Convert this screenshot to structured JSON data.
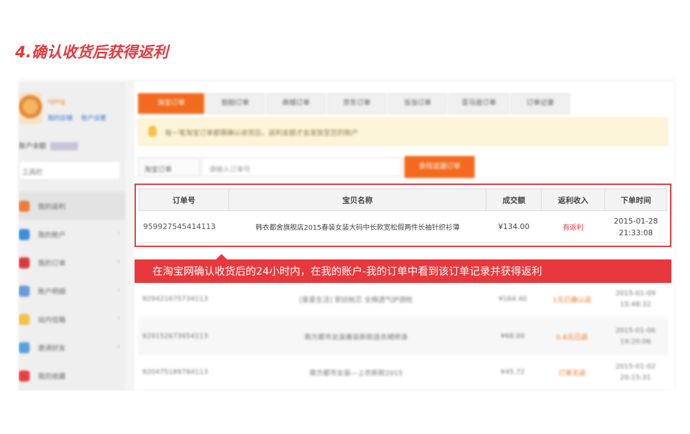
{
  "step_title": "4.确认收货后获得返利",
  "background": {
    "profile": {
      "name": "njmg",
      "links": [
        "我的店铺",
        "账户设置"
      ]
    },
    "account_label": "账户余额",
    "tools_label": "工具栏",
    "side_menu": [
      {
        "label": "我的返利",
        "icon": "gift-icon",
        "color": "#f07a3a"
      },
      {
        "label": "我的账户",
        "icon": "user-icon",
        "color": "#3a8fd8"
      },
      {
        "label": "我的订单",
        "icon": "order-icon",
        "color": "#d83a3a"
      },
      {
        "label": "账户明细",
        "icon": "list-icon",
        "color": "#6a9ad8"
      },
      {
        "label": "站内信箱",
        "icon": "mail-icon",
        "color": "#f5c243"
      },
      {
        "label": "邀请好友",
        "icon": "friends-icon",
        "color": "#5aa0e0"
      },
      {
        "label": "我的收藏",
        "icon": "heart-icon",
        "color": "#e84040"
      }
    ],
    "tabs": [
      "淘宝订单",
      "拍拍订单",
      "商城订单",
      "京东订单",
      "当当订单",
      "亚马逊订单",
      "订单记录"
    ],
    "notice": "每一笔淘宝订单都需确认收货后，返利金额才会发放至您的账户",
    "search_select": "淘宝订单",
    "search_placeholder": "请输入订单号",
    "search_button": "查找遗漏订单",
    "blurred_rows": [
      {
        "order": "929421675734113",
        "item": "[星星生活] 家纺枕芯 全棉透气护颈枕",
        "amount": "¥164.40",
        "rebate": "1元已确认返",
        "date": "2015-01-09",
        "time": "15:48:32"
      },
      {
        "order": "929152673654113",
        "item": "南方都市女装春装新款连衣裙修身",
        "amount": "¥68.00",
        "rebate": "0.6元已返",
        "date": "2015-01-06",
        "time": "19:20:06"
      },
      {
        "order": "920475189784113",
        "item": "南方都市女装—上衣新款2015",
        "amount": "¥45.72",
        "rebate": "订单无返",
        "date": "2015-01-02",
        "time": "20:15:31"
      }
    ]
  },
  "table": {
    "headers": [
      "订单号",
      "宝贝名称",
      "成交额",
      "返利收入",
      "下单时间"
    ],
    "row": {
      "order_no": "959927545414113",
      "item": "韩衣都舍旗舰店2015春装女装大码中长款宽松假两件长袖针织衫薄",
      "amount": "¥134.00",
      "rebate": "有返利",
      "date": "2015-01-28",
      "time": "21:33:08"
    }
  },
  "banner": "在淘宝网确认收货后的24小时内，在我的账户-我的订单中看到该订单记录并获得返利",
  "colors": {
    "accent": "#e8383d",
    "orange": "#f36a1e"
  }
}
